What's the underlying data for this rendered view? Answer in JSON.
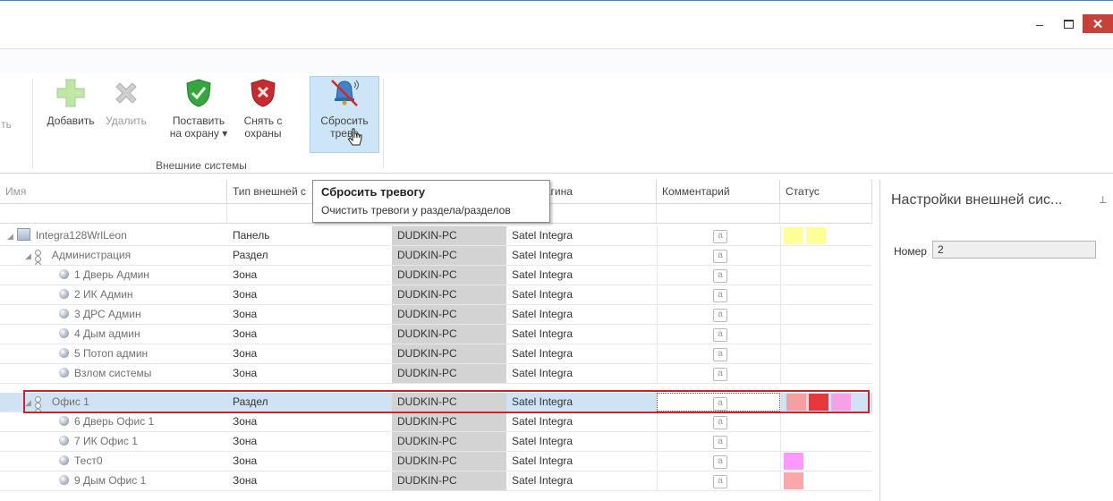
{
  "window": {
    "minimize_glyph": "–",
    "close_glyph": "✕"
  },
  "ribbon": {
    "truncated_label": "ть",
    "add_label": "Добавить",
    "delete_label": "Удалить",
    "arm_label_1": "Поставить",
    "arm_label_2": "на охрану ▾",
    "disarm_label_1": "Снять с",
    "disarm_label_2": "охраны",
    "reset_label_1": "Сбросить",
    "reset_label_2": "трево",
    "group_label": "Внешние системы"
  },
  "tooltip": {
    "title": "Сбросить тревогу",
    "description": "Очистить тревоги у раздела/разделов"
  },
  "grid": {
    "headers": {
      "name": "Имя",
      "type": "Тип внешней с",
      "plugin": "ние плагина",
      "comment": "Комментарий",
      "status": "Статус"
    },
    "comment_glyph": "a",
    "rows": [
      {
        "name": "Integra128WrlLeon",
        "type": "Панель",
        "pc": "DUDKIN-PC",
        "plugin": "Satel Integra",
        "status": [
          "#ffff99",
          "#ffff99"
        ]
      },
      {
        "name": "Администрация",
        "type": "Раздел",
        "pc": "DUDKIN-PC",
        "plugin": "Satel Integra",
        "status": []
      },
      {
        "name": "1 Дверь Админ",
        "type": "Зона",
        "pc": "DUDKIN-PC",
        "plugin": "Satel Integra",
        "status": []
      },
      {
        "name": "2 ИК Админ",
        "type": "Зона",
        "pc": "DUDKIN-PC",
        "plugin": "Satel Integra",
        "status": []
      },
      {
        "name": "3 ДРС Админ",
        "type": "Зона",
        "pc": "DUDKIN-PC",
        "plugin": "Satel Integra",
        "status": []
      },
      {
        "name": "4 Дым админ",
        "type": "Зона",
        "pc": "DUDKIN-PC",
        "plugin": "Satel Integra",
        "status": []
      },
      {
        "name": "5 Потоп админ",
        "type": "Зона",
        "pc": "DUDKIN-PC",
        "plugin": "Satel Integra",
        "status": []
      },
      {
        "name": "Взлом системы",
        "type": "Зона",
        "pc": "DUDKIN-PC",
        "plugin": "Satel Integra",
        "status": []
      },
      {
        "name": "Офис 1",
        "type": "Раздел",
        "pc": "DUDKIN-PC",
        "plugin": "Satel Integra",
        "status": [
          "#f4a0a0",
          "#e8373a",
          "#f7a0e8"
        ]
      },
      {
        "name": "6 Дверь Офис 1",
        "type": "Зона",
        "pc": "DUDKIN-PC",
        "plugin": "Satel Integra",
        "status": []
      },
      {
        "name": "7 ИК Офис 1",
        "type": "Зона",
        "pc": "DUDKIN-PC",
        "plugin": "Satel Integra",
        "status": []
      },
      {
        "name": "Тест0",
        "type": "Зона",
        "pc": "DUDKIN-PC",
        "plugin": "Satel Integra",
        "status": [
          "#ff99ff"
        ]
      },
      {
        "name": "9 Дым Офис 1",
        "type": "Зона",
        "pc": "DUDKIN-PC",
        "plugin": "Satel Integra",
        "status": [
          "#f8a8a8"
        ]
      }
    ]
  },
  "panel": {
    "title": "Настройки внешней сис...",
    "pin_glyph": "⊥",
    "number_label": "Номер",
    "number_value": "2"
  }
}
